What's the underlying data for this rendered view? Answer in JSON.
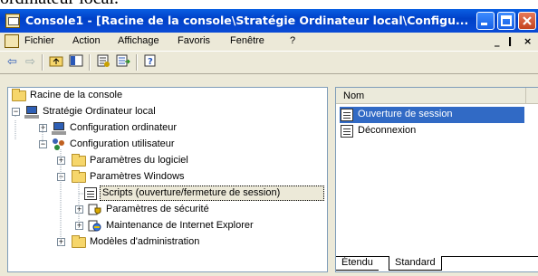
{
  "caption_text": "ordinateur local.",
  "window": {
    "title": "Console1 - [Racine de la console\\Stratégie Ordinateur local\\Configu...",
    "controls": [
      "minimize-icon",
      "maximize-icon",
      "close-icon"
    ]
  },
  "menubar": {
    "items": [
      "Fichier",
      "Action",
      "Affichage",
      "Favoris",
      "Fenêtre",
      "?"
    ],
    "mdi_controls": [
      "_",
      "ǀ",
      "×"
    ]
  },
  "toolbar": {
    "buttons": [
      "back-arrow-icon",
      "forward-arrow-icon",
      "up-folder-icon",
      "show-hide-tree-icon",
      "properties-icon",
      "export-list-icon",
      "help-icon"
    ]
  },
  "tree": {
    "items": [
      {
        "label": "Racine de la console",
        "icon": "folder-icon"
      },
      {
        "label": "Stratégie Ordinateur local",
        "icon": "policy-computer-icon",
        "expander": "-"
      },
      {
        "label": "Configuration ordinateur",
        "icon": "computer-icon",
        "expander": "+"
      },
      {
        "label": "Configuration utilisateur",
        "icon": "users-icon",
        "expander": "-"
      },
      {
        "label": "Paramètres du logiciel",
        "icon": "folder-icon",
        "expander": "+"
      },
      {
        "label": "Paramètres Windows",
        "icon": "folder-icon",
        "expander": "-"
      },
      {
        "label": "Scripts (ouverture/fermeture de session)",
        "icon": "script-icon",
        "selected": true
      },
      {
        "label": "Paramètres de sécurité",
        "icon": "security-icon",
        "expander": "+"
      },
      {
        "label": "Maintenance de Internet Explorer",
        "icon": "ie-maintenance-icon",
        "expander": "+"
      },
      {
        "label": "Modèles d'administration",
        "icon": "folder-icon",
        "expander": "+"
      }
    ]
  },
  "list": {
    "column_header": "Nom",
    "rows": [
      {
        "label": "Ouverture de session",
        "icon": "script-icon",
        "selected": true
      },
      {
        "label": "Déconnexion",
        "icon": "script-icon",
        "selected": false
      }
    ]
  },
  "tabs": {
    "items": [
      "Étendu",
      "Standard"
    ],
    "active": "Standard"
  },
  "colors": {
    "title_bar": "#0a4bd6",
    "selection": "#316ac5",
    "chrome": "#ece9d8"
  }
}
